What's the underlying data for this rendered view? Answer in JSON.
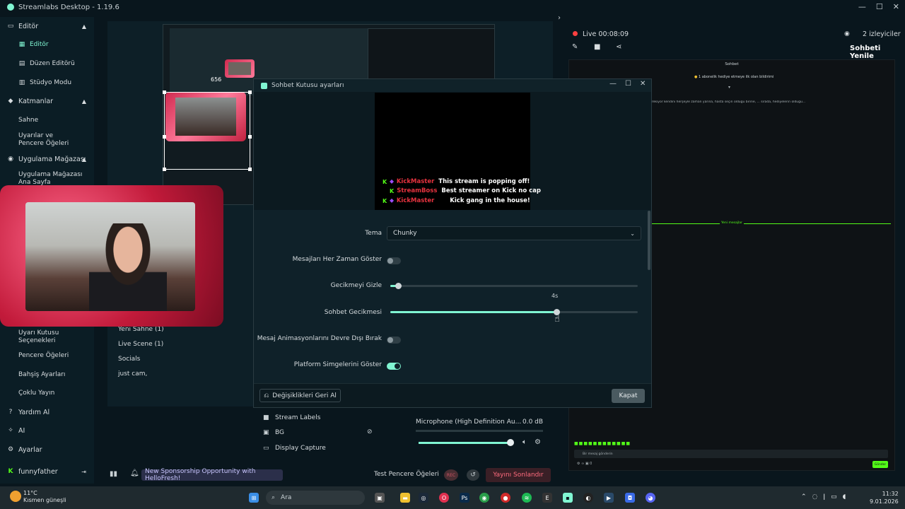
{
  "app": {
    "title": "Streamlabs Desktop - 1.19.6"
  },
  "sidebar": {
    "items": [
      {
        "label": "Editör",
        "type": "head"
      },
      {
        "label": "Editör",
        "type": "sub-active"
      },
      {
        "label": "Düzen Editörü",
        "type": "sub"
      },
      {
        "label": "Stüdyo Modu",
        "type": "sub"
      },
      {
        "label": "Katmanlar",
        "type": "head"
      },
      {
        "label": "Sahne",
        "type": "sub"
      },
      {
        "label": "Uyarılar ve Pencere Öğeleri",
        "type": "sub"
      },
      {
        "label": "Uygulama Mağazası",
        "type": "head"
      },
      {
        "label": "Uygulama Mağazası Ana Sayfa",
        "type": "sub"
      },
      {
        "label": "Uyarı Kutusu Seçenekleri",
        "type": "sub"
      },
      {
        "label": "Pencere Öğeleri",
        "type": "sub"
      },
      {
        "label": "Bahşiş Ayarları",
        "type": "sub"
      },
      {
        "label": "Çoklu Yayın",
        "type": "sub"
      },
      {
        "label": "Yardım Al",
        "type": "head"
      },
      {
        "label": "AI",
        "type": "head"
      },
      {
        "label": "Ayarlar",
        "type": "head"
      }
    ],
    "user": "funnyfather"
  },
  "editor": {
    "size_label": "656",
    "scenes": [
      "Yeni Sahne (1)",
      "Live Scene (1)",
      "Socials",
      "just cam,"
    ],
    "sources": [
      {
        "label": "Stream Labels",
        "icon": "folder-icon"
      },
      {
        "label": "BG",
        "icon": "image-icon"
      },
      {
        "label": "Display Capture",
        "icon": "monitor-icon"
      }
    ],
    "mixer": {
      "name": "Microphone (High Definition Au...",
      "db": "0.0 dB",
      "volume": 0.97
    }
  },
  "bottom_bar": {
    "sponsor": "New Sponsorship Opportunity with HelloFresh!",
    "test_label": "Test Pencere Öğeleri",
    "rec_label": "REC",
    "end_stream": "Yayını Sonlandır"
  },
  "right_panel": {
    "live_time": "Live 00:08:09",
    "viewers": "2 izleyiciler",
    "refresh_chat": "Sohbeti Yenile",
    "chat_title": "Sohbet",
    "chat_gift": "1 abonelik hediye etmeye ilk olan bildirimi",
    "chat_divider": "Yeni mesajlar",
    "chat_long": "n gerekiyor kendini herşeyle zaman yarına, hasta seçin olduğu birine, ... sırada, hediyelerin olduğu...",
    "chat_input": "Bir mesaj gönderin",
    "chat_send": "Gönder"
  },
  "modal": {
    "title": "Sohbet Kutusu ayarları",
    "preview_messages": [
      {
        "user": "KickMaster",
        "text": "This stream is popping off!"
      },
      {
        "user": "StreamBoss",
        "text": "Best streamer on Kick no cap"
      },
      {
        "user": "KickMaster",
        "text": "Kick gang in the house!"
      }
    ],
    "theme_label": "Tema",
    "theme_value": "Chunky",
    "always_show_label": "Mesajları Her Zaman Göster",
    "always_show": false,
    "hide_delay_label": "Gecikmeyi Gizle",
    "hide_delay_value": 0.03,
    "chat_delay_label": "Sohbet Gecikmesi",
    "chat_delay_tooltip": "4s",
    "chat_delay_value": 0.67,
    "disable_anim_label": "Mesaj Animasyonlarını Devre Dışı Bırak",
    "disable_anim": false,
    "platform_icons_label": "Platform Simgelerini Göster",
    "platform_icons": true,
    "revert_label": "Değişiklikleri Geri Al",
    "close_label": "Kapat"
  },
  "taskbar": {
    "weather_temp": "11°C",
    "weather_desc": "Kısmen güneşli",
    "search_placeholder": "Ara",
    "time": "11:32",
    "date": "9.01.2026"
  }
}
